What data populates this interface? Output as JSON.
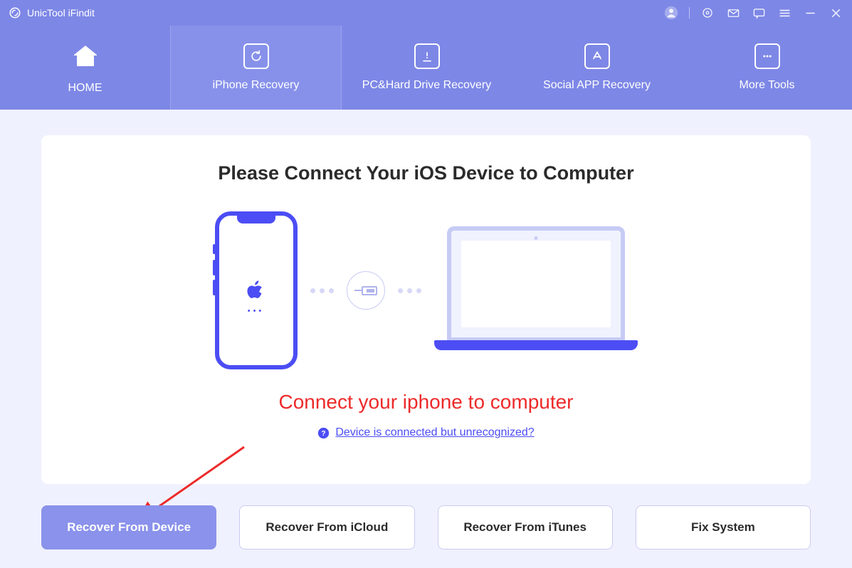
{
  "titlebar": {
    "app_name": "UnicTool iFindit"
  },
  "nav": {
    "home": "HOME",
    "iphone_recovery": "iPhone Recovery",
    "pc_recovery": "PC&Hard Drive Recovery",
    "social_recovery": "Social APP Recovery",
    "more_tools": "More Tools"
  },
  "main": {
    "heading": "Please Connect Your iOS Device to Computer",
    "annotation": "Connect your iphone to computer",
    "help_link": "Device is connected but unrecognized?"
  },
  "bottom": {
    "recover_device": "Recover From Device",
    "recover_icloud": "Recover From iCloud",
    "recover_itunes": "Recover From iTunes",
    "fix_system": "Fix System"
  }
}
